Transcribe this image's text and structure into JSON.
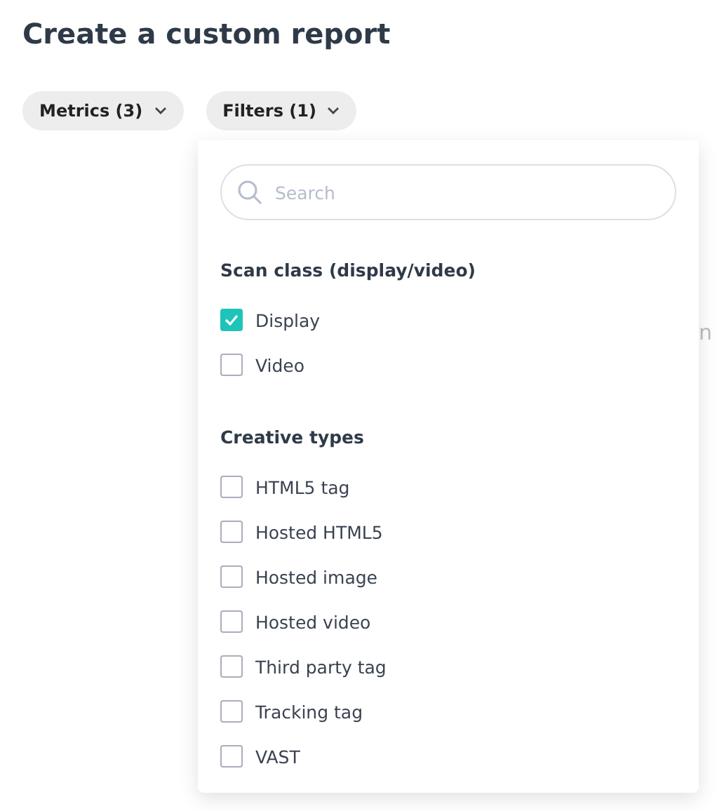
{
  "title": "Create a custom report",
  "chips": [
    {
      "label": "Metrics (3)"
    },
    {
      "label": "Filters (1)"
    }
  ],
  "background_text": "n",
  "dropdown": {
    "search": {
      "placeholder": "Search"
    },
    "sections": [
      {
        "heading": "Scan class (display/video)",
        "options": [
          {
            "label": "Display",
            "checked": true
          },
          {
            "label": "Video",
            "checked": false
          }
        ]
      },
      {
        "heading": "Creative types",
        "options": [
          {
            "label": "HTML5 tag",
            "checked": false
          },
          {
            "label": "Hosted HTML5",
            "checked": false
          },
          {
            "label": "Hosted image",
            "checked": false
          },
          {
            "label": "Hosted video",
            "checked": false
          },
          {
            "label": "Third party tag",
            "checked": false
          },
          {
            "label": "Tracking tag",
            "checked": false
          },
          {
            "label": "VAST",
            "checked": false
          }
        ]
      }
    ]
  }
}
